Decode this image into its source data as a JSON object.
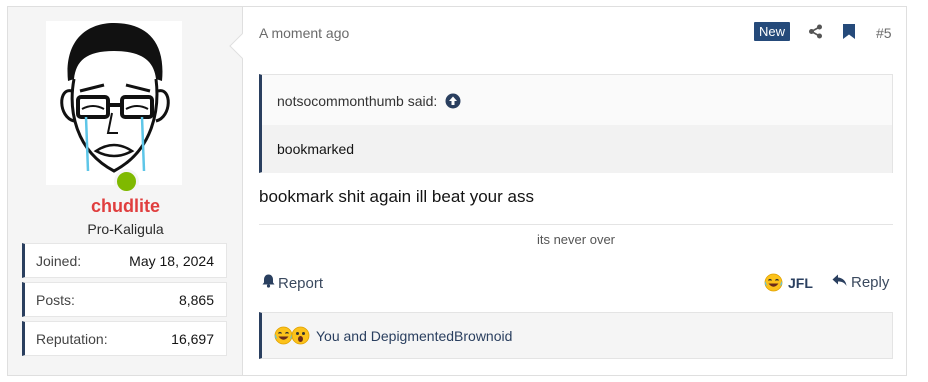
{
  "user": {
    "username": "chudlite",
    "title": "Pro-Kaligula",
    "stats": [
      {
        "label": "Joined:",
        "value": "May 18, 2024"
      },
      {
        "label": "Posts:",
        "value": "8,865"
      },
      {
        "label": "Reputation:",
        "value": "16,697"
      }
    ],
    "online_color": "#7fb900"
  },
  "post": {
    "timestamp": "A moment ago",
    "new_badge": "New",
    "number": "#5",
    "quote": {
      "author_line": "notsocommonthumb said:",
      "text": "bookmarked"
    },
    "message": "bookmark shit again ill beat your ass",
    "signature": "its never over",
    "actions": {
      "report": "Report",
      "reaction": "JFL",
      "reply": "Reply"
    },
    "reactions_summary": "You and DepigmentedBrownoid"
  },
  "colors": {
    "accent": "#2a3f5f",
    "username": "#e03e3e",
    "new_badge_bg": "#254a7a"
  },
  "icons": [
    "share-icon",
    "bookmark-icon",
    "up-arrow-icon",
    "bell-icon",
    "laughing-crying-emoji-icon",
    "reply-arrow-icon",
    "shocked-emoji-icon"
  ]
}
